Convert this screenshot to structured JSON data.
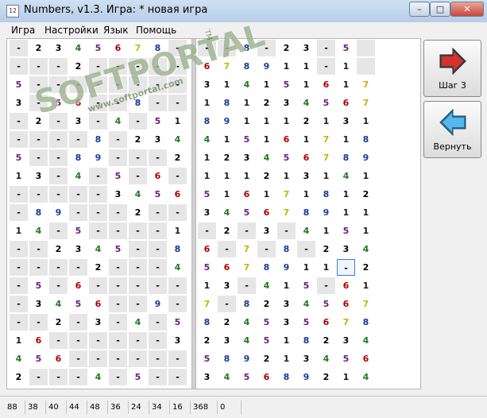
{
  "window": {
    "title": "Numbers, v1.3. Игра: * новая игра",
    "buttons": {
      "minimize": "–",
      "maximize": "□",
      "close": "✕"
    }
  },
  "menu": [
    "Игра",
    "Настройки",
    "Язык",
    "Помощь"
  ],
  "side": {
    "step_label": "Шаг 3",
    "back_label": "Вернуть"
  },
  "watermark": {
    "brand": "SOFTPORTAL",
    "url": "www.softportal.com",
    "tm": "TM"
  },
  "status": [
    "88",
    "38",
    "40",
    "44",
    "48",
    "36",
    "24",
    "34",
    "16",
    "368",
    "0"
  ],
  "left_board": [
    [
      "-",
      "2",
      "3",
      "4",
      "5",
      "6",
      "7",
      "8",
      "-"
    ],
    [
      "-",
      "-",
      "-",
      "2",
      "-",
      "-",
      "-",
      "-",
      "-"
    ],
    [
      "5",
      "-",
      "-",
      "-",
      "-",
      "-",
      "-",
      "-",
      "-"
    ],
    [
      "3",
      "-",
      "5",
      "6",
      "-",
      "-",
      "8",
      "-",
      "-"
    ],
    [
      "-",
      "2",
      "-",
      "3",
      "-",
      "4",
      "-",
      "5",
      "1"
    ],
    [
      "-",
      "-",
      "-",
      "-",
      "8",
      "-",
      "2",
      "3",
      "4"
    ],
    [
      "5",
      "-",
      "-",
      "8",
      "9",
      "-",
      "-",
      "-",
      "2"
    ],
    [
      "1",
      "3",
      "-",
      "4",
      "-",
      "5",
      "-",
      "6",
      "-"
    ],
    [
      "-",
      "-",
      "-",
      "-",
      "-",
      "3",
      "4",
      "5",
      "6"
    ],
    [
      "-",
      "8",
      "9",
      "-",
      "-",
      "-",
      "2",
      "-",
      "-"
    ],
    [
      "1",
      "4",
      "-",
      "5",
      "-",
      "-",
      "-",
      "-",
      "1"
    ],
    [
      "-",
      "-",
      "2",
      "3",
      "4",
      "5",
      "-",
      "-",
      "8"
    ],
    [
      "-",
      "-",
      "-",
      "-",
      "2",
      "-",
      "-",
      "-",
      "4"
    ],
    [
      "-",
      "5",
      "-",
      "6",
      "-",
      "-",
      "-",
      "-",
      "-"
    ],
    [
      "-",
      "3",
      "4",
      "5",
      "6",
      "-",
      "-",
      "9",
      "-"
    ],
    [
      "-",
      "-",
      "2",
      "-",
      "3",
      "-",
      "4",
      "-",
      "5"
    ],
    [
      "1",
      "6",
      "-",
      "-",
      "-",
      "-",
      "-",
      "-",
      "3"
    ],
    [
      "4",
      "5",
      "6",
      "-",
      "-",
      "-",
      "-",
      "-",
      "-"
    ],
    [
      "2",
      "-",
      "-",
      "-",
      "4",
      "-",
      "5",
      "-",
      "-"
    ]
  ],
  "right_board": [
    [
      "-",
      "-",
      "8",
      "-",
      "2",
      "3",
      "-",
      "5"
    ],
    [
      "6",
      "7",
      "8",
      "9",
      "1",
      "1",
      "-",
      "1"
    ],
    [
      "3",
      "1",
      "4",
      "1",
      "5",
      "1",
      "6",
      "1",
      "7"
    ],
    [
      "1",
      "8",
      "1",
      "2",
      "3",
      "4",
      "5",
      "6",
      "7"
    ],
    [
      "8",
      "9",
      "1",
      "1",
      "1",
      "2",
      "1",
      "3",
      "1"
    ],
    [
      "4",
      "1",
      "5",
      "1",
      "6",
      "1",
      "7",
      "1",
      "8"
    ],
    [
      "1",
      "2",
      "3",
      "4",
      "5",
      "6",
      "7",
      "8",
      "9"
    ],
    [
      "1",
      "1",
      "1",
      "2",
      "1",
      "3",
      "1",
      "4",
      "1"
    ],
    [
      "5",
      "1",
      "6",
      "1",
      "7",
      "1",
      "8",
      "1",
      "2"
    ],
    [
      "3",
      "4",
      "5",
      "6",
      "7",
      "8",
      "9",
      "1",
      "1"
    ],
    [
      "-",
      "2",
      "-",
      "3",
      "-",
      "4",
      "1",
      "5",
      "1"
    ],
    [
      "6",
      "-",
      "7",
      "-",
      "8",
      "-",
      "2",
      "3",
      "4"
    ],
    [
      "5",
      "6",
      "7",
      "8",
      "9",
      "1",
      "1",
      "-",
      "2"
    ],
    [
      "1",
      "3",
      "-",
      "4",
      "1",
      "5",
      "-",
      "6",
      "1"
    ],
    [
      "7",
      "-",
      "8",
      "2",
      "3",
      "4",
      "5",
      "6",
      "7"
    ],
    [
      "8",
      "2",
      "4",
      "5",
      "3",
      "5",
      "6",
      "7",
      "8"
    ],
    [
      "2",
      "3",
      "4",
      "5",
      "1",
      "8",
      "2",
      "3",
      "4"
    ],
    [
      "5",
      "8",
      "9",
      "2",
      "1",
      "3",
      "4",
      "5",
      "6"
    ],
    [
      "3",
      "4",
      "5",
      "6",
      "8",
      "9",
      "2",
      "1",
      "4"
    ]
  ]
}
